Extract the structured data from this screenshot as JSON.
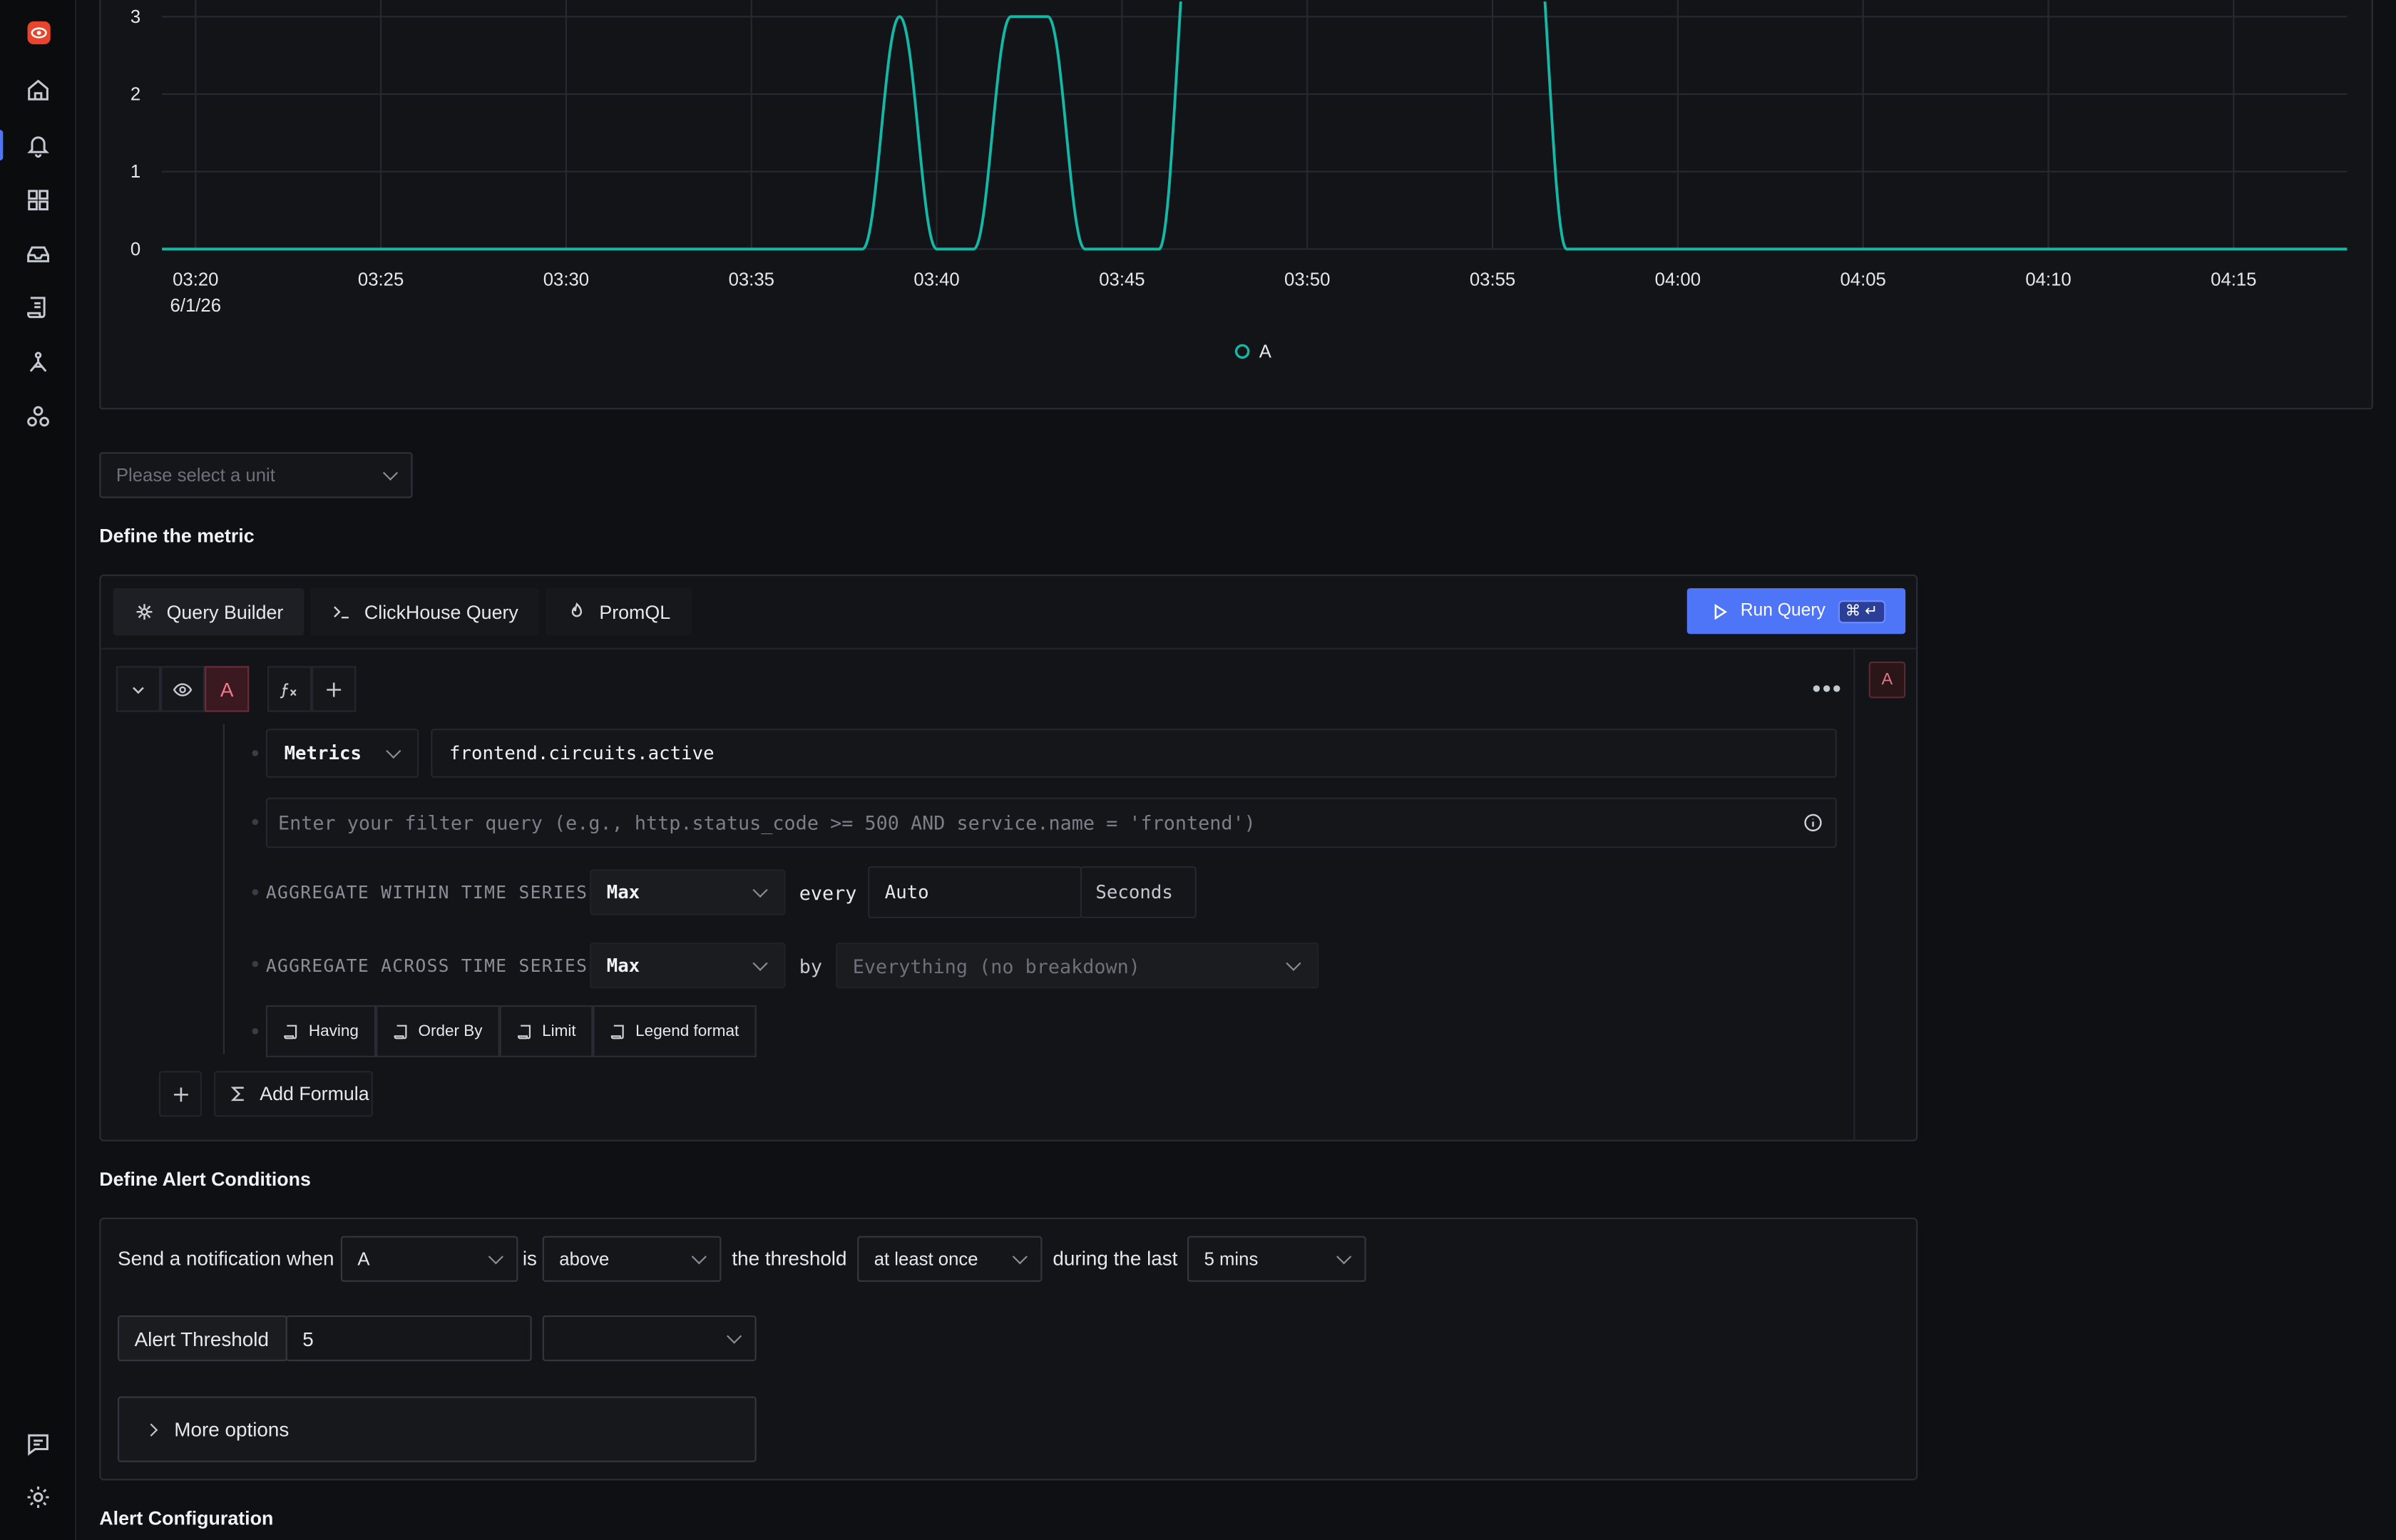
{
  "chart": {
    "legend": "A",
    "y_ticks": [
      "3",
      "2",
      "1",
      "0"
    ],
    "x_ticks": [
      "03:20",
      "03:25",
      "03:30",
      "03:35",
      "03:40",
      "03:45",
      "03:50",
      "03:55",
      "04:00",
      "04:05",
      "04:10",
      "04:15"
    ],
    "date_label": "6/1/26",
    "line_color": "#14b8a6"
  },
  "chart_data": {
    "type": "line",
    "title": "",
    "xlabel": "",
    "ylabel": "",
    "y_visible_range": [
      0,
      3
    ],
    "grid": true,
    "legend_position": "bottom-center",
    "series": [
      {
        "name": "A",
        "x": [
          "03:19",
          "03:38",
          "03:39",
          "03:40",
          "03:41",
          "03:42",
          "03:43",
          "03:44",
          "03:45",
          "03:46",
          "03:47",
          "03:48",
          "03:56",
          "03:57",
          "04:18"
        ],
        "values": [
          0,
          0,
          3,
          0,
          0,
          3,
          3,
          0,
          0,
          0,
          5,
          5,
          5,
          0,
          0
        ]
      }
    ]
  },
  "unit_select": {
    "placeholder": "Please select a unit"
  },
  "define_metric": {
    "title": "Define the metric",
    "tabs": [
      "Query Builder",
      "ClickHouse Query",
      "PromQL"
    ],
    "run_query": "Run Query",
    "run_shortcut": "⌘ ↵",
    "query_letter": "A",
    "data_source": "Metrics",
    "metric_name": "frontend.circuits.active",
    "filter_placeholder": "Enter your filter query (e.g., http.status_code >= 500 AND service.name = 'frontend')",
    "agg_within_label": "AGGREGATE WITHIN TIME SERIES",
    "agg_within_value": "Max",
    "every_label": "every",
    "every_value": "Auto",
    "every_unit": "Seconds",
    "agg_across_label": "AGGREGATE ACROSS TIME SERIES",
    "agg_across_value": "Max",
    "by_label": "by",
    "by_placeholder": "Everything (no breakdown)",
    "options": [
      "Having",
      "Order By",
      "Limit",
      "Legend format"
    ],
    "add_formula": "Add Formula"
  },
  "alert_conditions": {
    "title": "Define Alert Conditions",
    "send_when": "Send a notification when",
    "query": "A",
    "is": "is",
    "op": "above",
    "the_threshold": "the threshold",
    "match_type": "at least once",
    "during_last": "during the last",
    "window": "5 mins",
    "threshold_label": "Alert Threshold",
    "threshold_value": "5",
    "more_options": "More options"
  },
  "alert_configuration": {
    "title": "Alert Configuration"
  }
}
